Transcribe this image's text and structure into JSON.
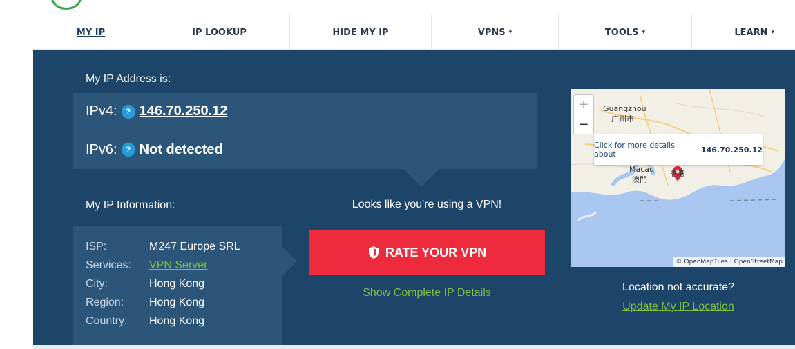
{
  "nav": {
    "items": [
      {
        "label": "MY IP",
        "dropdown": false,
        "active": true
      },
      {
        "label": "IP LOOKUP",
        "dropdown": false
      },
      {
        "label": "HIDE MY IP",
        "dropdown": false
      },
      {
        "label": "VPNS",
        "dropdown": true
      },
      {
        "label": "TOOLS",
        "dropdown": true
      },
      {
        "label": "LEARN",
        "dropdown": true
      }
    ],
    "caret": "▾"
  },
  "ip": {
    "heading": "My IP Address is:",
    "ipv4_label": "IPv4:",
    "ipv4_value": "146.70.250.12",
    "ipv6_label": "IPv6:",
    "ipv6_value": "Not detected",
    "help_glyph": "?"
  },
  "info": {
    "heading": "My IP Information:",
    "rows": [
      {
        "key": "ISP:",
        "value": "M247 Europe SRL"
      },
      {
        "key": "Services:",
        "value": "VPN Server"
      },
      {
        "key": "City:",
        "value": "Hong Kong"
      },
      {
        "key": "Region:",
        "value": "Hong Kong"
      },
      {
        "key": "Country:",
        "value": "Hong Kong"
      }
    ]
  },
  "vpn": {
    "message": "Looks like you're using a VPN!",
    "rate_button": "RATE YOUR VPN",
    "details_link": "Show Complete IP Details"
  },
  "map": {
    "zoom_in": "+",
    "zoom_out": "−",
    "labels": {
      "guangzhou": "Guangzhou",
      "guangzhou_cn": "广州市",
      "macau": "Macau",
      "macau_cn": "澳門",
      "hongkong_cn": "香港"
    },
    "popup_text": "Click for more details about",
    "popup_ip": "146.70.250.12",
    "attribution": "© OpenMapTiles | OpenStreetMap"
  },
  "location": {
    "message": "Location not accurate?",
    "update_link": "Update My IP Location"
  },
  "colors": {
    "panel": "#1d4469",
    "box": "#2b5579",
    "accent_green": "#7cc242",
    "rate_red": "#ee2b3c",
    "help_blue": "#2a9ad9",
    "sea": "#a9c6f0"
  }
}
